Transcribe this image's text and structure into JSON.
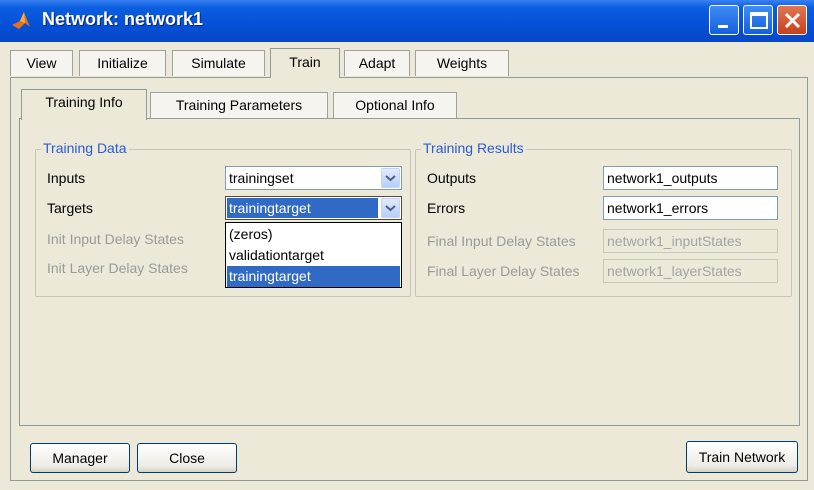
{
  "window": {
    "title": "Network: network1"
  },
  "tabs": [
    "View",
    "Initialize",
    "Simulate",
    "Train",
    "Adapt",
    "Weights"
  ],
  "active_tab": "Train",
  "subtabs": [
    "Training Info",
    "Training Parameters",
    "Optional Info"
  ],
  "active_subtab": "Training Info",
  "training_data": {
    "title": "Training Data",
    "inputs_label": "Inputs",
    "inputs_value": "trainingset",
    "targets_label": "Targets",
    "targets_value": "trainingtarget",
    "init_input_delay_label": "Init Input Delay States",
    "init_layer_delay_label": "Init Layer Delay States",
    "targets_dropdown_options": [
      "(zeros)",
      "validationtarget",
      "trainingtarget"
    ],
    "targets_dropdown_selected": "trainingtarget"
  },
  "training_results": {
    "title": "Training Results",
    "outputs_label": "Outputs",
    "outputs_value": "network1_outputs",
    "errors_label": "Errors",
    "errors_value": "network1_errors",
    "final_input_delay_label": "Final Input Delay States",
    "final_input_delay_value": "network1_inputStates",
    "final_layer_delay_label": "Final Layer Delay States",
    "final_layer_delay_value": "network1_layerStates"
  },
  "buttons": {
    "manager": "Manager",
    "close": "Close",
    "train_network": "Train Network"
  },
  "colors": {
    "titlebar": "#0550d8",
    "group_title": "#2a5bd7",
    "selection": "#316ac5"
  }
}
